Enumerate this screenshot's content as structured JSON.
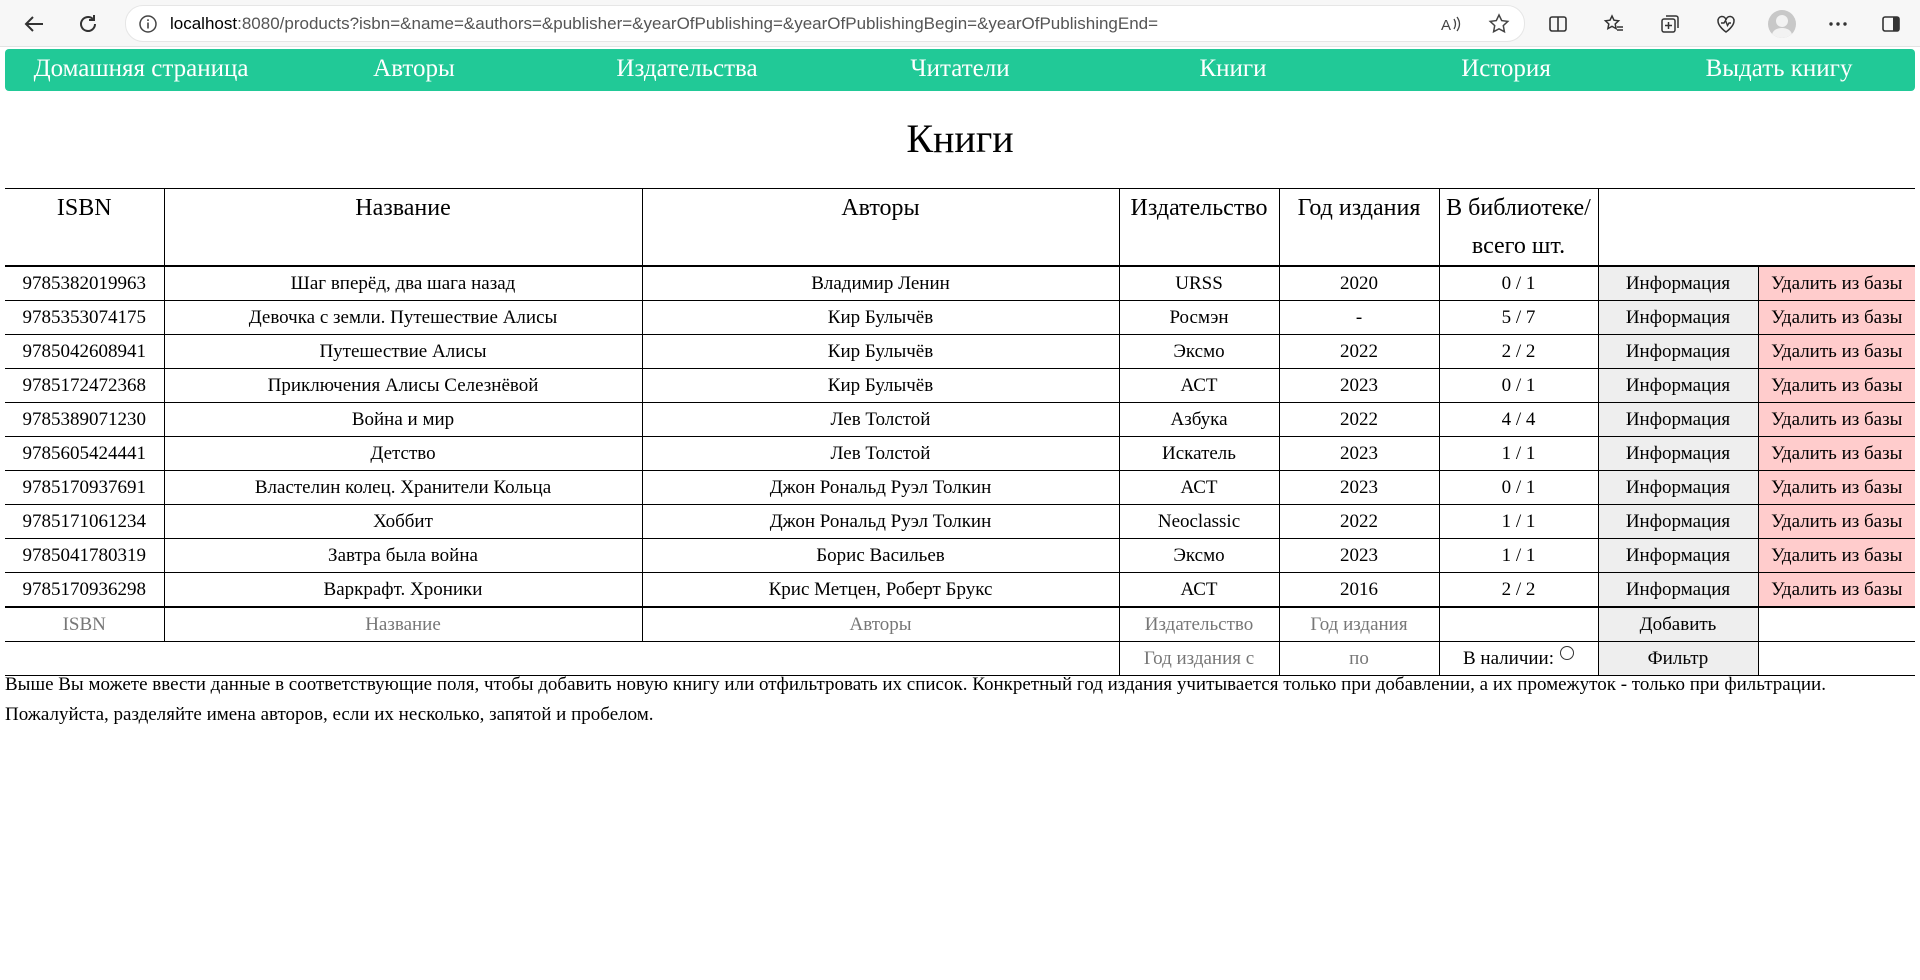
{
  "browser": {
    "url_host": "localhost",
    "url_rest": ":8080/products?isbn=&name=&authors=&publisher=&yearOfPublishing=&yearOfPublishingBegin=&yearOfPublishingEnd="
  },
  "nav": {
    "items": [
      {
        "label": "Домашняя страница"
      },
      {
        "label": "Авторы"
      },
      {
        "label": "Издательства"
      },
      {
        "label": "Читатели"
      },
      {
        "label": "Книги"
      },
      {
        "label": "История"
      },
      {
        "label": "Выдать книгу"
      }
    ]
  },
  "title": "Книги",
  "table": {
    "headers": {
      "isbn": "ISBN",
      "name": "Название",
      "authors": "Авторы",
      "publisher": "Издательство",
      "year": "Год издания",
      "stock_line1": "В библиотеке/",
      "stock_line2": "всего шт."
    },
    "rows": [
      {
        "isbn": "9785382019963",
        "name": "Шаг вперёд, два шага назад",
        "authors": "Владимир Ленин",
        "publisher": "URSS",
        "year": "2020",
        "stock": "0 / 1"
      },
      {
        "isbn": "9785353074175",
        "name": "Девочка с земли. Путешествие Алисы",
        "authors": "Кир Булычёв",
        "publisher": "Росмэн",
        "year": "-",
        "stock": "5 / 7"
      },
      {
        "isbn": "9785042608941",
        "name": "Путешествие Алисы",
        "authors": "Кир Булычёв",
        "publisher": "Эксмо",
        "year": "2022",
        "stock": "2 / 2"
      },
      {
        "isbn": "9785172472368",
        "name": "Приключения Алисы Селезнёвой",
        "authors": "Кир Булычёв",
        "publisher": "АСТ",
        "year": "2023",
        "stock": "0 / 1"
      },
      {
        "isbn": "9785389071230",
        "name": "Война и мир",
        "authors": "Лев Толстой",
        "publisher": "Азбука",
        "year": "2022",
        "stock": "4 / 4"
      },
      {
        "isbn": "9785605424441",
        "name": "Детство",
        "authors": "Лев Толстой",
        "publisher": "Искатель",
        "year": "2023",
        "stock": "1 / 1"
      },
      {
        "isbn": "9785170937691",
        "name": "Властелин колец. Хранители Кольца",
        "authors": "Джон Рональд Руэл Толкин",
        "publisher": "АСТ",
        "year": "2023",
        "stock": "0 / 1"
      },
      {
        "isbn": "9785171061234",
        "name": "Хоббит",
        "authors": "Джон Рональд Руэл Толкин",
        "publisher": "Neoclassic",
        "year": "2022",
        "stock": "1 / 1"
      },
      {
        "isbn": "9785041780319",
        "name": "Завтра была война",
        "authors": "Борис Васильев",
        "publisher": "Эксмо",
        "year": "2023",
        "stock": "1 / 1"
      },
      {
        "isbn": "9785170936298",
        "name": "Варкрафт. Хроники",
        "authors": "Крис Метцен, Роберт Брукс",
        "publisher": "АСТ",
        "year": "2016",
        "stock": "2 / 2"
      }
    ],
    "info_label": "Информация",
    "delete_label": "Удалить из базы"
  },
  "form": {
    "isbn_placeholder": "ISBN",
    "name_placeholder": "Название",
    "authors_placeholder": "Авторы",
    "publisher_placeholder": "Издательство",
    "year_placeholder": "Год издания",
    "add_label": "Добавить",
    "year_begin_placeholder": "Год издания с",
    "year_end_placeholder": "по",
    "availability_label": "В наличии:",
    "filter_label": "Фильтр"
  },
  "help_text": "Выше Вы можете ввести данные в соответствующие поля, чтобы добавить новую книгу или отфильтровать их список. Конкретный год издания учитывается только при добавлении, а их промежуток - только при фильтрации. Пожалуйста, разделяйте имена авторов, если их несколько, запятой и пробелом."
}
